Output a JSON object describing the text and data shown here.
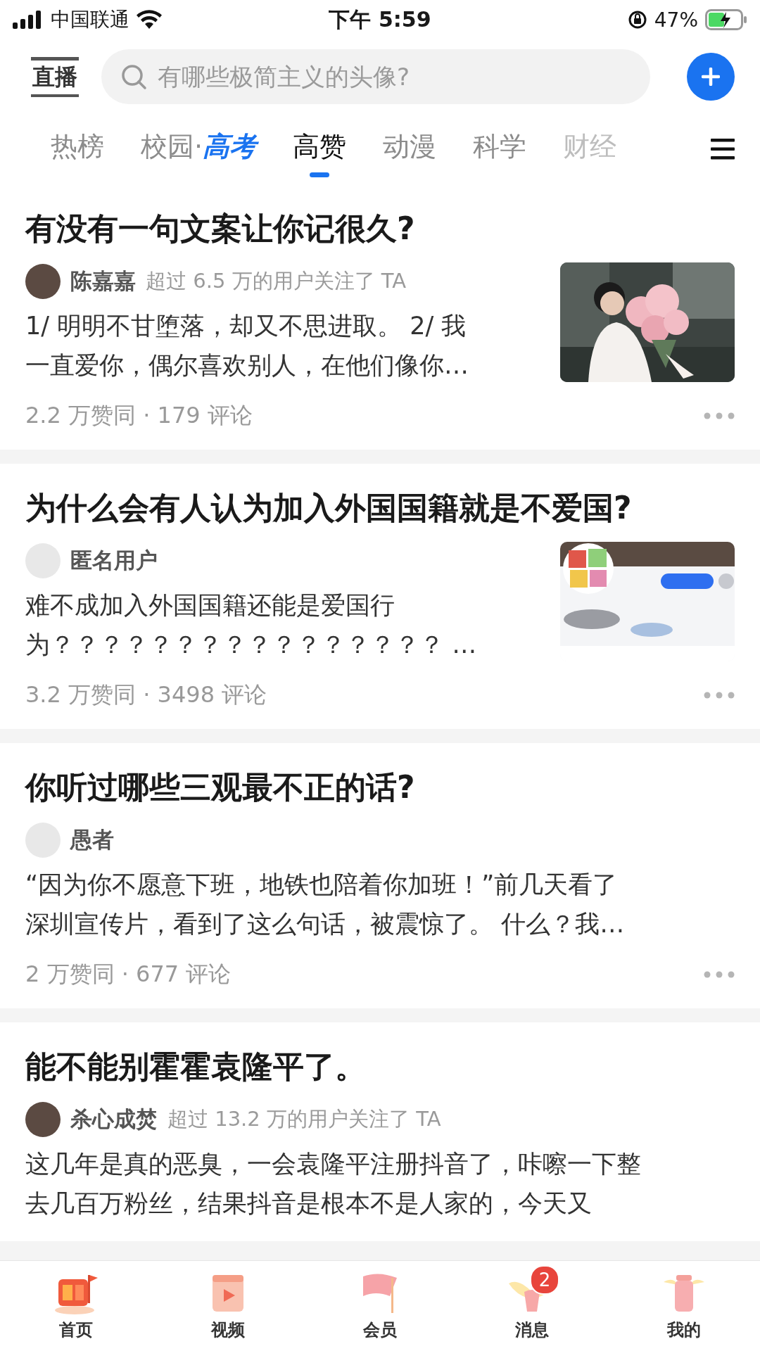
{
  "status_bar": {
    "carrier": "中国联通",
    "time": "下午 5:59",
    "battery": "47%"
  },
  "header": {
    "live_label": "直播",
    "search": {
      "placeholder": "有哪些极简主义的头像?"
    }
  },
  "tabs": [
    {
      "label": "热榜",
      "selected": false
    },
    {
      "label": "校园·",
      "highlight": "高考",
      "selected": false
    },
    {
      "label": "高赞",
      "selected": true
    },
    {
      "label": "动漫",
      "selected": false
    },
    {
      "label": "科学",
      "selected": false
    },
    {
      "label": "财经",
      "selected": false,
      "faded": true
    }
  ],
  "feed": [
    {
      "title": "有没有一句文案让你记很久?",
      "avatar_photo": true,
      "author": "陈嘉嘉",
      "follower_note": "超过 6.5 万的用户关注了 TA",
      "excerpt": [
        "1/ 明明不甘堕落，却又不思进取。 2/ 我",
        "一直爱你，偶尔喜欢别人，在他们像你…"
      ],
      "stats": "2.2 万赞同 · 179 评论"
    },
    {
      "title": "为什么会有人认为加入外国国籍就是不爱国?",
      "avatar_photo": false,
      "author": "匿名用户",
      "excerpt": [
        "难不成加入外国国籍还能是爱国行",
        "为？？？？？？？？？？？？？？？？ …"
      ],
      "stats": "3.2 万赞同 · 3498 评论"
    },
    {
      "title": "你听过哪些三观最不正的话?",
      "avatar_photo": false,
      "author": "愚者",
      "excerpt": [
        "“因为你不愿意下班，地铁也陪着你加班！”前几天看了",
        "深圳宣传片，看到了这么句话，被震惊了。 什么？我…"
      ],
      "stats": "2 万赞同 · 677 评论"
    },
    {
      "title": "能不能别霍霍袁隆平了。",
      "avatar_photo": true,
      "author": "杀心成焚",
      "follower_note": "超过 13.2 万的用户关注了 TA",
      "excerpt": [
        "这几年是真的恶臭，一会袁隆平注册抖音了，咔嚓一下整",
        "去几百万粉丝，结果抖音是根本不是人家的，今天又"
      ]
    }
  ],
  "nav": [
    {
      "label": "首页"
    },
    {
      "label": "视频"
    },
    {
      "label": "会员"
    },
    {
      "label": "消息",
      "badge": "2"
    },
    {
      "label": "我的"
    }
  ]
}
